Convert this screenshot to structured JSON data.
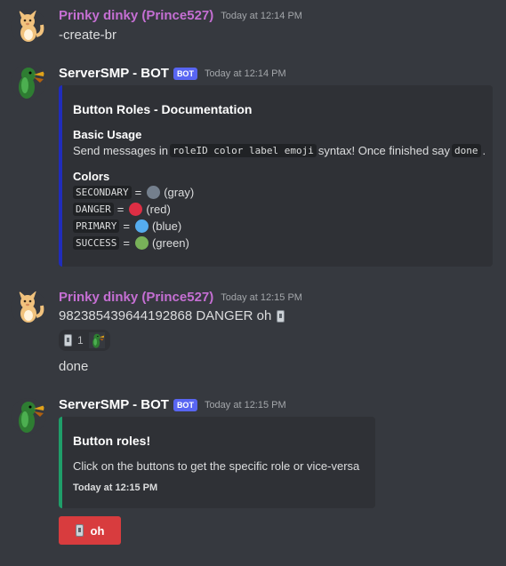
{
  "messages": [
    {
      "username": "Prinky dinky (Prince527)",
      "username_color": "#c56fd3",
      "timestamp": "Today at 12:14 PM",
      "content": "-create-br"
    },
    {
      "username": "ServerSMP - BOT",
      "username_color": "#ffffff",
      "badge": "BOT",
      "timestamp": "Today at 12:14 PM",
      "embed": {
        "color": "#202cbb",
        "title": "Button Roles - Documentation",
        "field1_name": "Basic Usage",
        "field1_pre": "Send messages in",
        "field1_code": "roleID color label emoji",
        "field1_mid": "syntax! Once finished say",
        "field1_code2": "done",
        "field1_post": ".",
        "field2_name": "Colors",
        "colors": [
          {
            "code": "SECONDARY",
            "label": "(gray)",
            "swatch": "#747f8d"
          },
          {
            "code": "DANGER",
            "label": "(red)",
            "swatch": "#dd2e44"
          },
          {
            "code": "PRIMARY",
            "label": "(blue)",
            "swatch": "#55acee"
          },
          {
            "code": "SUCCESS",
            "label": "(green)",
            "swatch": "#78b159"
          }
        ],
        "eq": "="
      }
    },
    {
      "username": "Prinky dinky (Prince527)",
      "username_color": "#c56fd3",
      "timestamp": "Today at 12:15 PM",
      "content": "982385439644192868 DANGER oh",
      "reaction_count": "1",
      "content2": "done"
    },
    {
      "username": "ServerSMP - BOT",
      "username_color": "#ffffff",
      "badge": "BOT",
      "timestamp": "Today at 12:15 PM",
      "embed": {
        "color": "#1f9e69",
        "title": "Button roles!",
        "description": "Click on the buttons to get the specific role or vice-versa",
        "footer": "Today at 12:15 PM"
      },
      "button_label": "oh",
      "button_color": "#d83c3e"
    }
  ]
}
